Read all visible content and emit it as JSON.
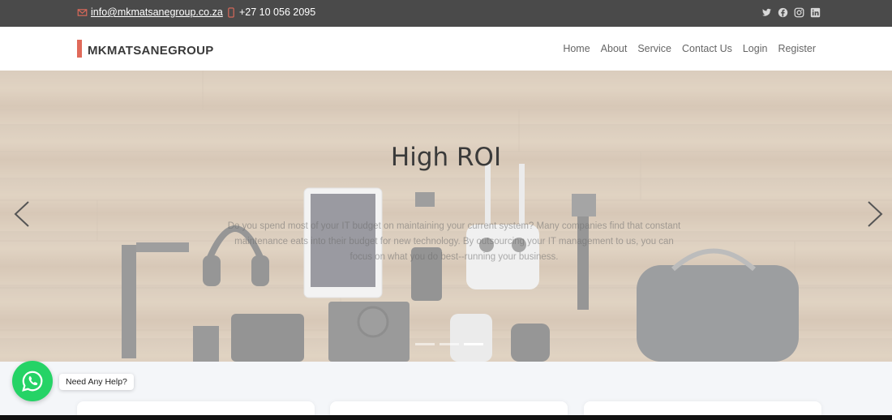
{
  "topbar": {
    "email": "info@mkmatsanegroup.co.za",
    "phone": "+27 10 056 2095",
    "socials": [
      "twitter-icon",
      "facebook-icon",
      "instagram-icon",
      "linkedin-icon"
    ]
  },
  "header": {
    "logo_text": "MKMATSANEGROUP",
    "nav": [
      "Home",
      "About",
      "Service",
      "Contact Us",
      "Login",
      "Register"
    ]
  },
  "hero": {
    "title": "High ROI",
    "text": "Do you spend most of your IT budget on maintaining your current system? Many companies find that constant maintenance eats into their budget for new technology. By outsourcing your IT management to us, you can focus on what you do best--running your business.",
    "slides_total": 3,
    "active_slide": 3
  },
  "whatsapp": {
    "label": "Need Any Help?"
  },
  "colors": {
    "topbar_bg": "#4a4a4a",
    "accent": "#e06a5a",
    "whatsapp": "#25d366"
  }
}
